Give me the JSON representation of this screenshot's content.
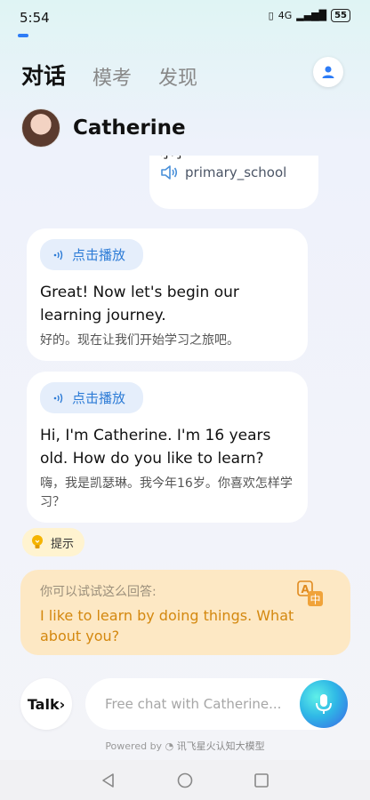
{
  "status": {
    "time": "5:54",
    "network": "4G",
    "battery": "55"
  },
  "tabs": [
    {
      "label": "对话",
      "active": true
    },
    {
      "label": "模考",
      "active": false
    },
    {
      "label": "发现",
      "active": false
    }
  ],
  "character": {
    "name": "Catherine"
  },
  "messages": {
    "user_partial": {
      "cut_text": "小学",
      "speak_text": "primary_school"
    },
    "ai": [
      {
        "play_label": "点击播放",
        "en": "Great! Now let's begin our learning journey.",
        "zh": "好的。现在让我们开始学习之旅吧。"
      },
      {
        "play_label": "点击播放",
        "en": "Hi, I'm Catherine. I'm 16 years old. How do you like to learn?",
        "zh": "嗨，我是凯瑟琳。我今年16岁。你喜欢怎样学习？"
      }
    ]
  },
  "hint": {
    "label": "提示"
  },
  "suggestion": {
    "label": "你可以试试这么回答:",
    "text": "I like to learn by doing things. What about you?"
  },
  "input": {
    "talk_label": "Talk›",
    "placeholder": "Free chat with Catherine..."
  },
  "footer": {
    "powered_label": "Powered by",
    "brand": "讯飞星火认知大模型"
  },
  "colors": {
    "accent": "#2d7cf6",
    "play_chip_text": "#2c7bd6",
    "suggestion_bg": "#fde8c4",
    "suggestion_text": "#d4880f"
  }
}
